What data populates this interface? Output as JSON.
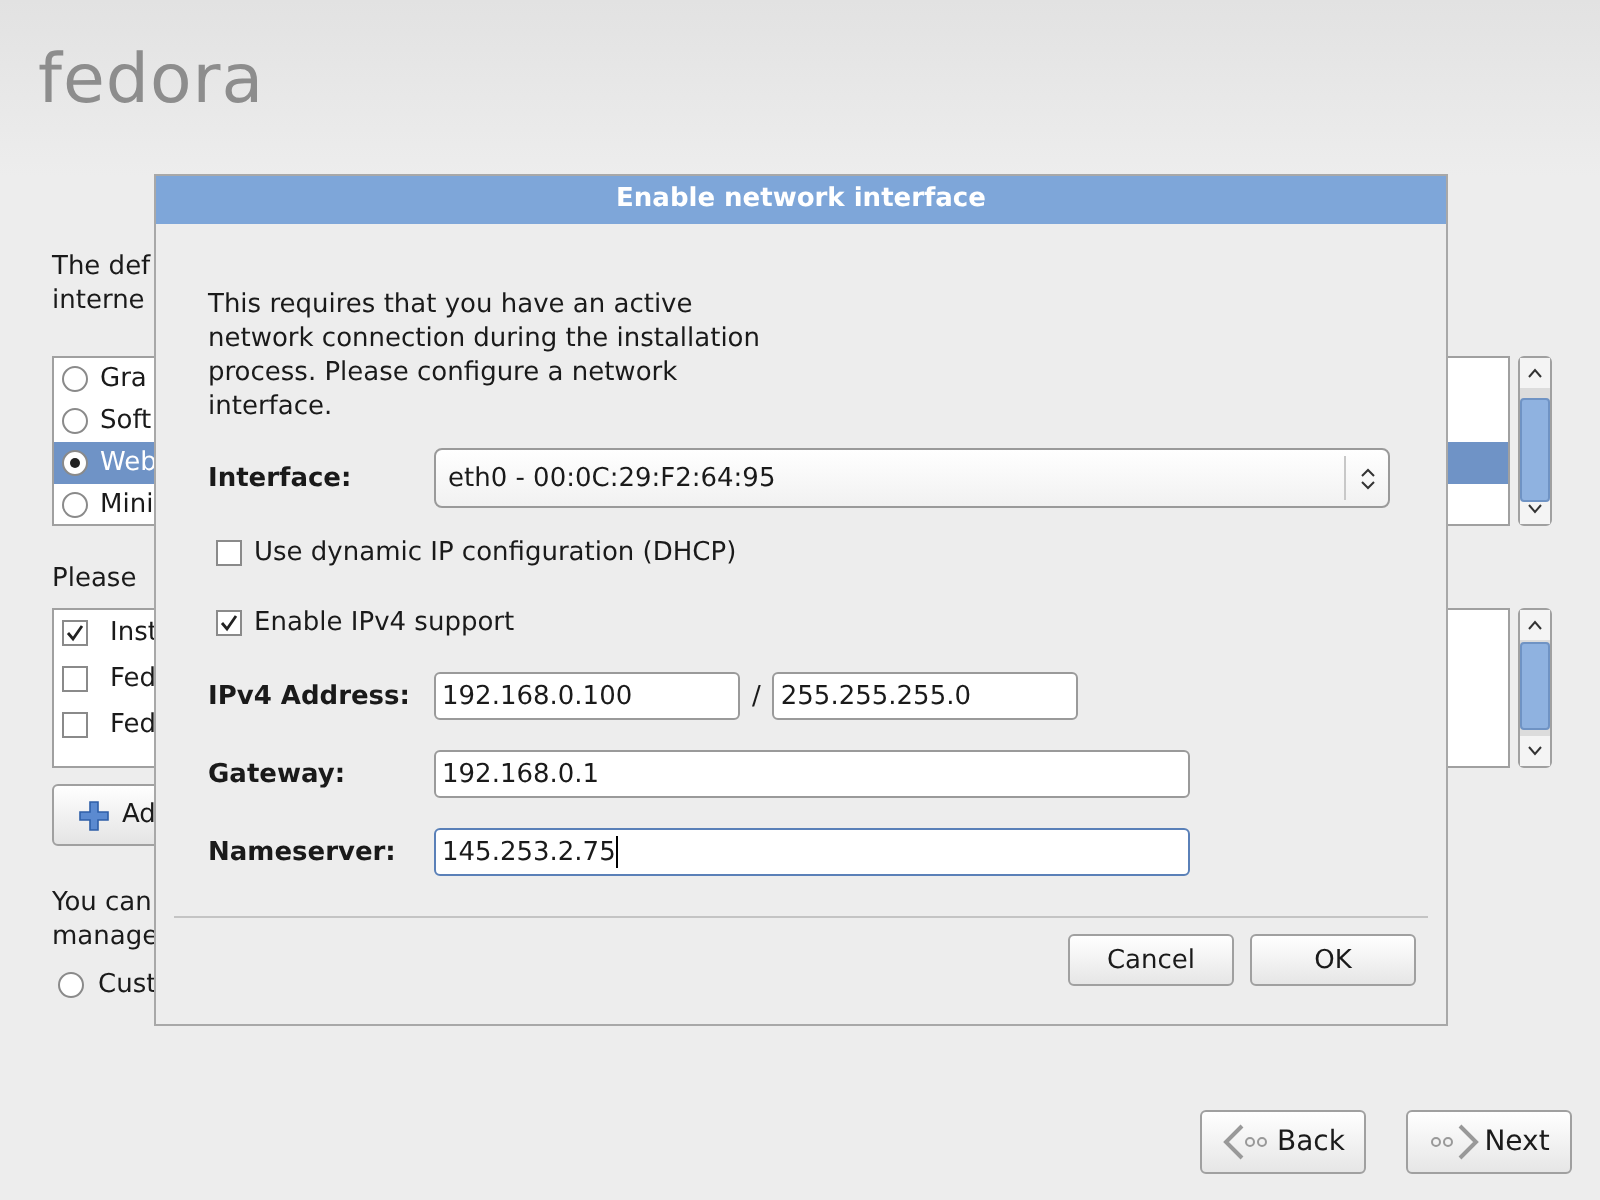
{
  "logo": {
    "text": "fedora"
  },
  "background": {
    "intro_lines": [
      "The def",
      "interne"
    ],
    "radio_list": [
      {
        "label": "Gra",
        "selected": false
      },
      {
        "label": "Soft",
        "selected": false
      },
      {
        "label": "Web",
        "selected": true
      },
      {
        "label": "Mini",
        "selected": false
      }
    ],
    "prompt": "Please",
    "check_list": [
      {
        "label": "Inst",
        "checked": true
      },
      {
        "label": "Fed",
        "checked": false
      },
      {
        "label": "Fed",
        "checked": false
      }
    ],
    "add_button": "Ad",
    "note_lines": [
      "You can",
      "manage"
    ],
    "custom_radio": {
      "label": "Cust",
      "selected": false
    }
  },
  "dialog": {
    "title": "Enable network interface",
    "message": "This requires that you have an active network connection during the installation process.  Please configure a network interface.",
    "interface": {
      "label": "Interface:",
      "value": "eth0 - 00:0C:29:F2:64:95"
    },
    "dhcp": {
      "label": "Use dynamic IP configuration (DHCP)",
      "checked": false
    },
    "ipv4": {
      "label": "Enable IPv4 support",
      "checked": true
    },
    "ipv4_address": {
      "label": "IPv4 Address:",
      "value": "192.168.0.100",
      "separator": "/",
      "netmask": "255.255.255.0"
    },
    "gateway": {
      "label": "Gateway:",
      "value": "192.168.0.1"
    },
    "nameserver": {
      "label": "Nameserver:",
      "value": "145.253.2.75",
      "focused": true
    },
    "buttons": [
      "Cancel",
      "OK"
    ]
  },
  "nav_buttons": [
    {
      "label": "Back",
      "kind": "back"
    },
    {
      "label": "Next",
      "kind": "next"
    }
  ]
}
